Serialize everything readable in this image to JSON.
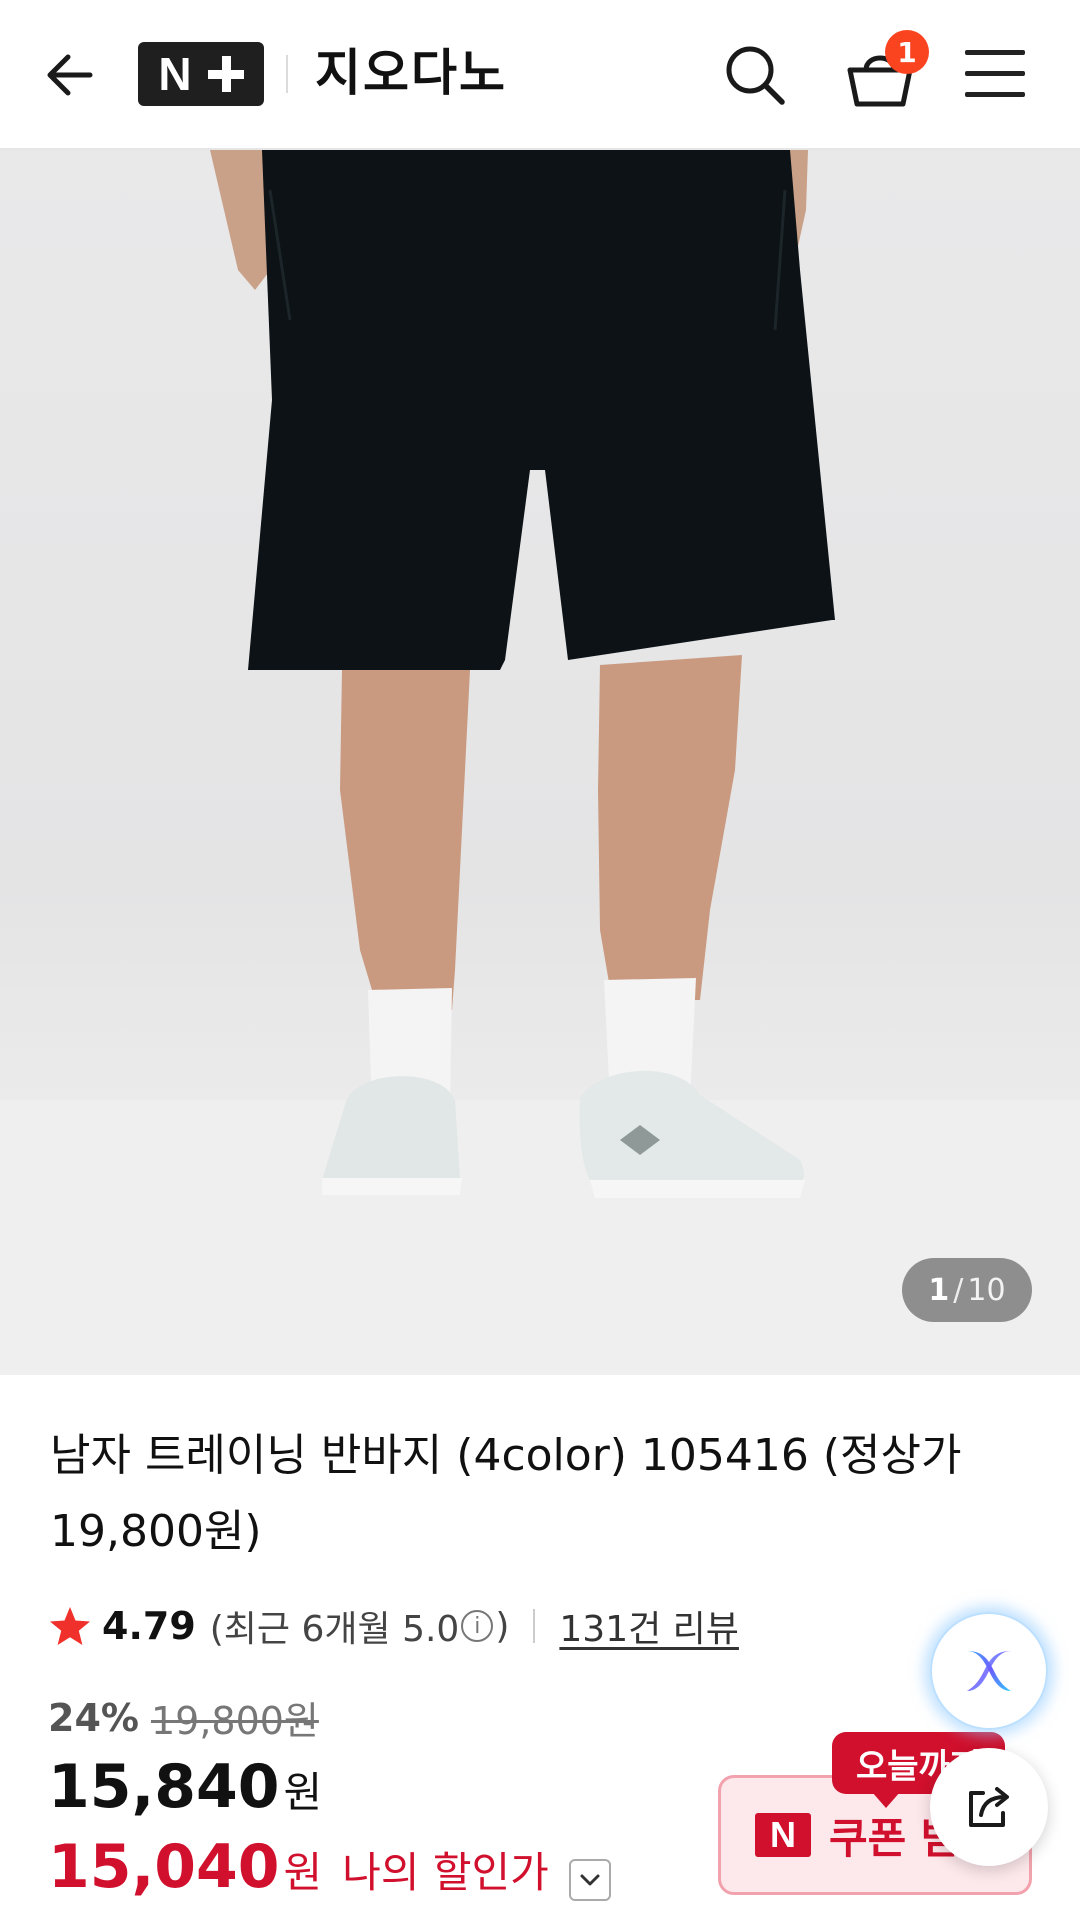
{
  "header": {
    "logo_letter": "N",
    "store_name": "지오다노",
    "cart_count": "1"
  },
  "gallery": {
    "current": "1",
    "separator": "/",
    "total": "10"
  },
  "product": {
    "title": "남자 트레이닝 반바지 (4color) 105416 (정상가 19,800원)",
    "rating": "4.79",
    "rating_recent_prefix": "(최근 6개월 5.0",
    "rating_recent_suffix": ")",
    "info_glyph": "i",
    "review_link": "131건 리뷰",
    "discount_rate": "24%",
    "original_price": "19,800원",
    "price": "15,840",
    "price_unit": "원",
    "my_price": "15,040",
    "my_price_unit": "원",
    "my_price_label": "나의 할인가"
  },
  "coupon": {
    "badge": "오늘까지",
    "logo_letter": "N",
    "label": "쿠폰 받"
  },
  "icons": {
    "back": "arrow-left-icon",
    "search": "search-icon",
    "cart": "shopping-basket-icon",
    "menu": "hamburger-menu-icon",
    "star": "star-icon",
    "chevron": "chevron-down-icon",
    "ai": "ai-assistant-icon",
    "share": "share-icon"
  },
  "colors": {
    "accent_red": "#d1102d",
    "badge_orange": "#fa4420",
    "star_red": "#f0302a"
  }
}
